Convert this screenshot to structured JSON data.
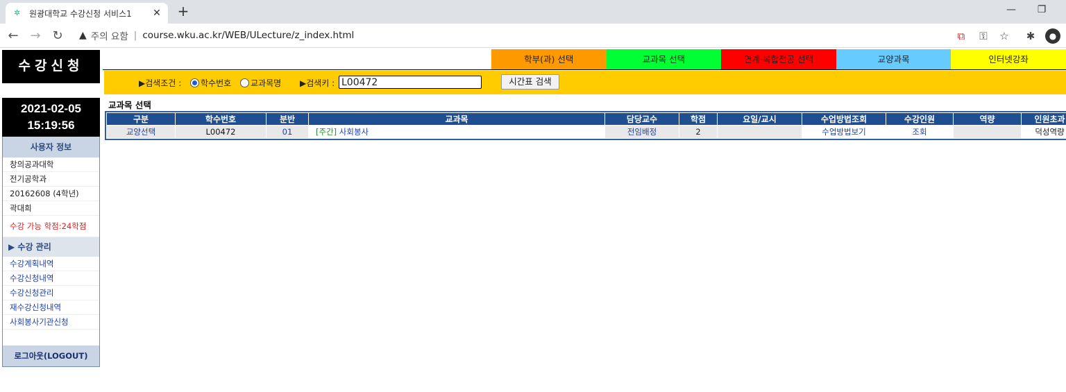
{
  "browser": {
    "tab_title": "원광대학교 수강신청 서비스1",
    "security_label": "주의 요함",
    "url": "course.wku.ac.kr/WEB/ULecture/z_index.html"
  },
  "sidebar": {
    "logo": "수강신청",
    "date": "2021-02-05",
    "time": "15:19:56",
    "user_info_heading": "사용자 정보",
    "user": {
      "college": "창의공과대학",
      "department": "전기공학과",
      "student_id": "20162608 (4학년)",
      "name": "곽대희"
    },
    "credit_notice": "수강 가능 학점:24학점",
    "management_heading": "▶ 수강 관리",
    "links": [
      "수강계획내역",
      "수강신청내역",
      "수강신청관리",
      "재수강신청내역",
      "사회봉사기관신청"
    ],
    "logout": "로그아웃(LOGOUT)"
  },
  "menu": {
    "items": [
      {
        "label": "학부(과) 선택",
        "color": "#ff9900"
      },
      {
        "label": "교과목 선택",
        "color": "#00ff33"
      },
      {
        "label": "연계·복합전공 선택",
        "color": "#ff0000"
      },
      {
        "label": "교양과목",
        "color": "#66ccff"
      },
      {
        "label": "인터넷강좌",
        "color": "#ffff00"
      }
    ]
  },
  "search": {
    "condition_label": "▶검색조건 :",
    "option_code": "학수번호",
    "option_name": "교과목명",
    "key_label": "▶검색키 :",
    "key_value": "L00472",
    "button": "시간표 검색"
  },
  "section_title": "교과목 선택",
  "table": {
    "headers": [
      "구분",
      "학수번호",
      "분반",
      "교과목",
      "담당교수",
      "학점",
      "요일/교시",
      "수업방법조회",
      "수강인원",
      "역량",
      "인원초과"
    ],
    "row": {
      "category": "교양선택",
      "code": "L00472",
      "section": "01",
      "course_tag": "[주간]",
      "course_name": "사회봉사",
      "professor": "전임배정",
      "credits": "2",
      "schedule": "",
      "method": "수업방법보기",
      "enrollment": "조회",
      "competency": "",
      "overflow": "덕성역량"
    }
  }
}
